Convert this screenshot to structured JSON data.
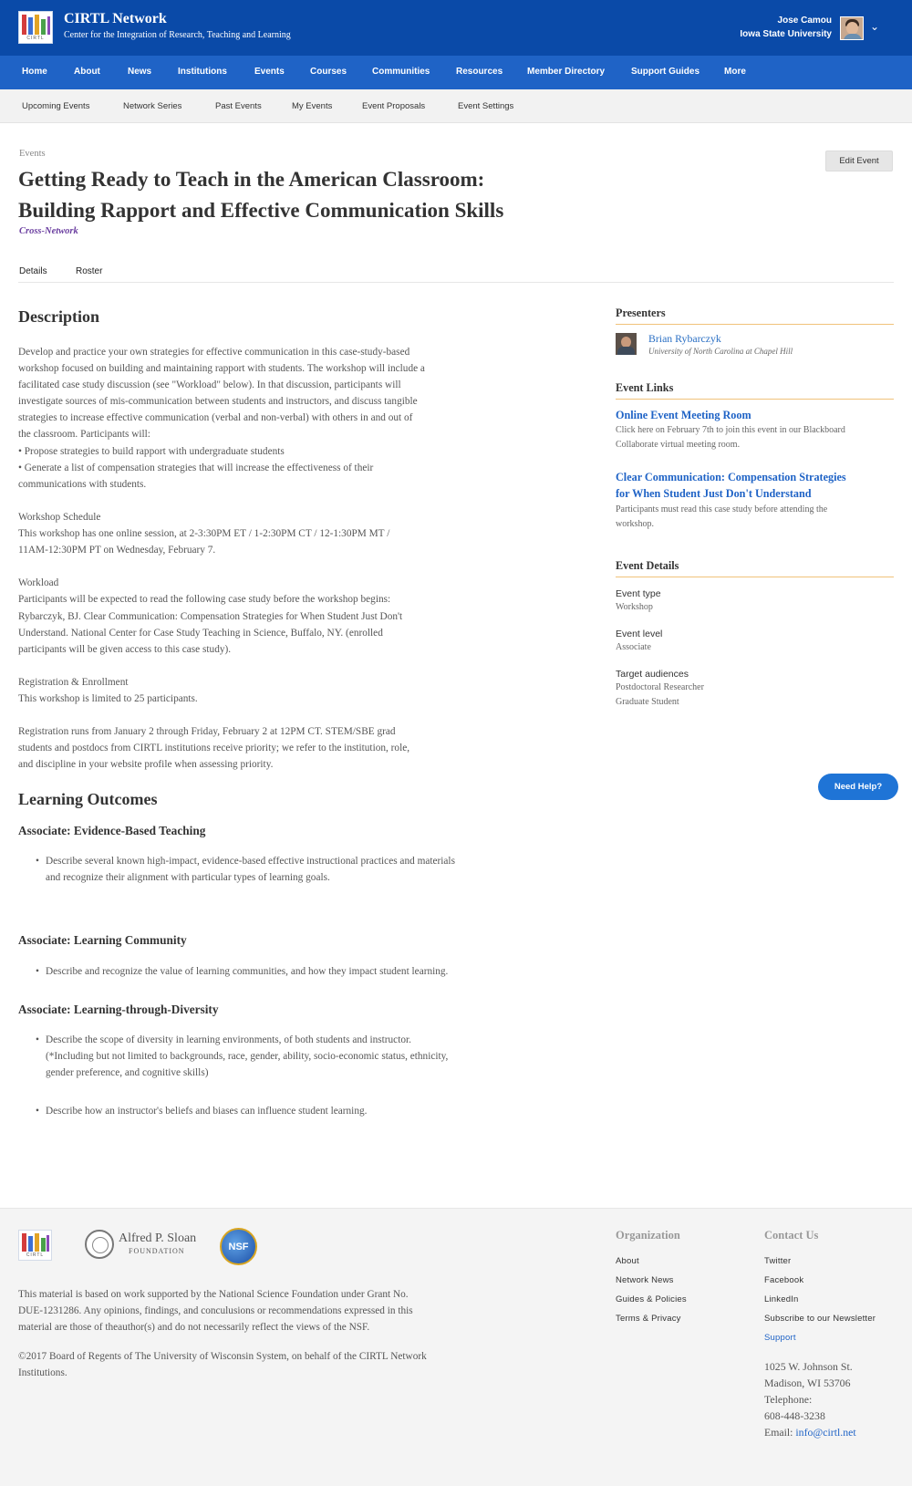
{
  "header": {
    "brand_name": "CIRTL Network",
    "brand_subtitle": "Center for the Integration of Research, Teaching and Learning",
    "logo_text": "CIRTL",
    "user_name": "Jose Camou",
    "user_org": "Iowa State University",
    "user_menu_icon": "chevron-down-icon"
  },
  "main_nav": [
    "Home",
    "About",
    "News",
    "Institutions",
    "Events",
    "Courses",
    "Communities",
    "Resources",
    "Member Directory",
    "Support Guides",
    "More"
  ],
  "sub_nav": [
    "Upcoming Events",
    "Network Series",
    "Past Events",
    "My Events",
    "Event Proposals",
    "Event Settings"
  ],
  "event": {
    "breadcrumb": "Events",
    "title_line1": "Getting Ready to Teach in the American Classroom:",
    "title_line2": "Building Rapport and Effective Communication Skills",
    "tag": "Cross-Network",
    "edit_button": "Edit Event",
    "tabs": [
      "Details",
      "Roster"
    ]
  },
  "description": {
    "heading": "Description",
    "paragraph1": [
      "Develop and practice your own strategies for effective communication in this case-study-based",
      "workshop focused on building and maintaining rapport with students. The workshop will include a",
      "facilitated case study discussion (see \"Workload\" below). In that discussion, participants will",
      "investigate sources of mis-communication between students and instructors, and discuss tangible",
      "strategies to increase effective communication (verbal and non-verbal) with others in and out of",
      "the classroom. Participants will:",
      "• Propose strategies to build rapport with undergraduate students",
      "• Generate a list of compensation strategies that will increase the effectiveness of their",
      "communications with students."
    ],
    "paragraph2": [
      "Workshop Schedule",
      "This workshop has one online session, at 2-3:30PM ET / 1-2:30PM CT / 12-1:30PM MT /",
      "11AM-12:30PM PT on Wednesday, February 7."
    ],
    "paragraph3": [
      "Workload",
      "Participants will be expected to read the following case study before the workshop begins:",
      "Rybarczyk, BJ. Clear Communication: Compensation Strategies for When Student Just Don't",
      "Understand. National Center for Case Study Teaching in Science, Buffalo, NY. (enrolled",
      "participants will be given access to this case study)."
    ],
    "paragraph4": [
      "Registration & Enrollment",
      "This workshop is limited to 25 participants."
    ],
    "paragraph5": [
      "Registration runs from January 2 through Friday, February 2 at 12PM CT. STEM/SBE grad",
      "students and postdocs from CIRTL institutions receive priority; we refer to the institution, role,",
      "and discipline in your website profile when assessing priority."
    ]
  },
  "learning_outcomes": {
    "heading": "Learning Outcomes",
    "groups": [
      {
        "title": "Associate: Evidence-Based Teaching",
        "items": [
          [
            "Describe several known high-impact, evidence-based effective instructional practices and materials",
            "and recognize their alignment with particular types of learning goals."
          ]
        ]
      },
      {
        "title": "Associate: Learning Community",
        "items": [
          [
            "Describe and recognize the value of learning communities, and how they impact student learning."
          ]
        ]
      },
      {
        "title": "Associate: Learning-through-Diversity",
        "items": [
          [
            "Describe the scope of diversity in learning environments, of both students and instructor.",
            "(*Including but not limited to backgrounds, race, gender, ability, socio-economic status, ethnicity,",
            "gender preference, and cognitive skills)"
          ],
          [
            "Describe how an instructor's beliefs and biases can influence student learning."
          ]
        ]
      }
    ]
  },
  "sidebar": {
    "presenters_heading": "Presenters",
    "presenter_name": "Brian Rybarczyk",
    "presenter_institution": "University of North Carolina at Chapel Hill",
    "links_heading": "Event Links",
    "link1_title": "Online Event Meeting Room",
    "link1_note": [
      "Click here on February 7th to join this event in our Blackboard",
      "Collaborate virtual meeting room."
    ],
    "link2_title": [
      "Clear Communication: Compensation Strategies",
      "for When Student Just Don't Understand"
    ],
    "link2_note": [
      "Participants must read this case study before attending the",
      "workshop."
    ],
    "details_heading": "Event Details",
    "event_type_label": "Event type",
    "event_type": "Workshop",
    "event_level_label": "Event level",
    "event_level": "Associate",
    "audiences_label": "Target audiences",
    "audiences": [
      "Postdoctoral Researcher",
      "Graduate Student"
    ]
  },
  "help_button": "Need Help?",
  "footer": {
    "cirtl_logo_text": "CIRTL",
    "sloan_name": "Alfred P. Sloan",
    "sloan_sub": "FOUNDATION",
    "nsf_text": "NSF",
    "legal1": [
      "This material is based on work supported by the National Science Foundation under Grant No.",
      "DUE-1231286. Any opinions, findings, and conculusions or recommendations expressed in this",
      "material are those of theauthor(s) and do not necessarily reflect the views of the NSF."
    ],
    "legal2": [
      "©2017 Board of Regents of The University of Wisconsin System, on behalf of the CIRTL Network",
      "Institutions."
    ],
    "org_heading": "Organization",
    "org_links": [
      "About",
      "Network News",
      "Guides & Policies",
      "Terms & Privacy"
    ],
    "contact_heading": "Contact Us",
    "contact_links": [
      "Twitter",
      "Facebook",
      "LinkedIn",
      "Subscribe to our Newsletter",
      "Support"
    ],
    "address": [
      "1025 W. Johnson St.",
      "Madison, WI 53706",
      "Telephone:",
      "608-448-3238"
    ],
    "email_label": "Email: ",
    "email": "info@cirtl.net"
  }
}
